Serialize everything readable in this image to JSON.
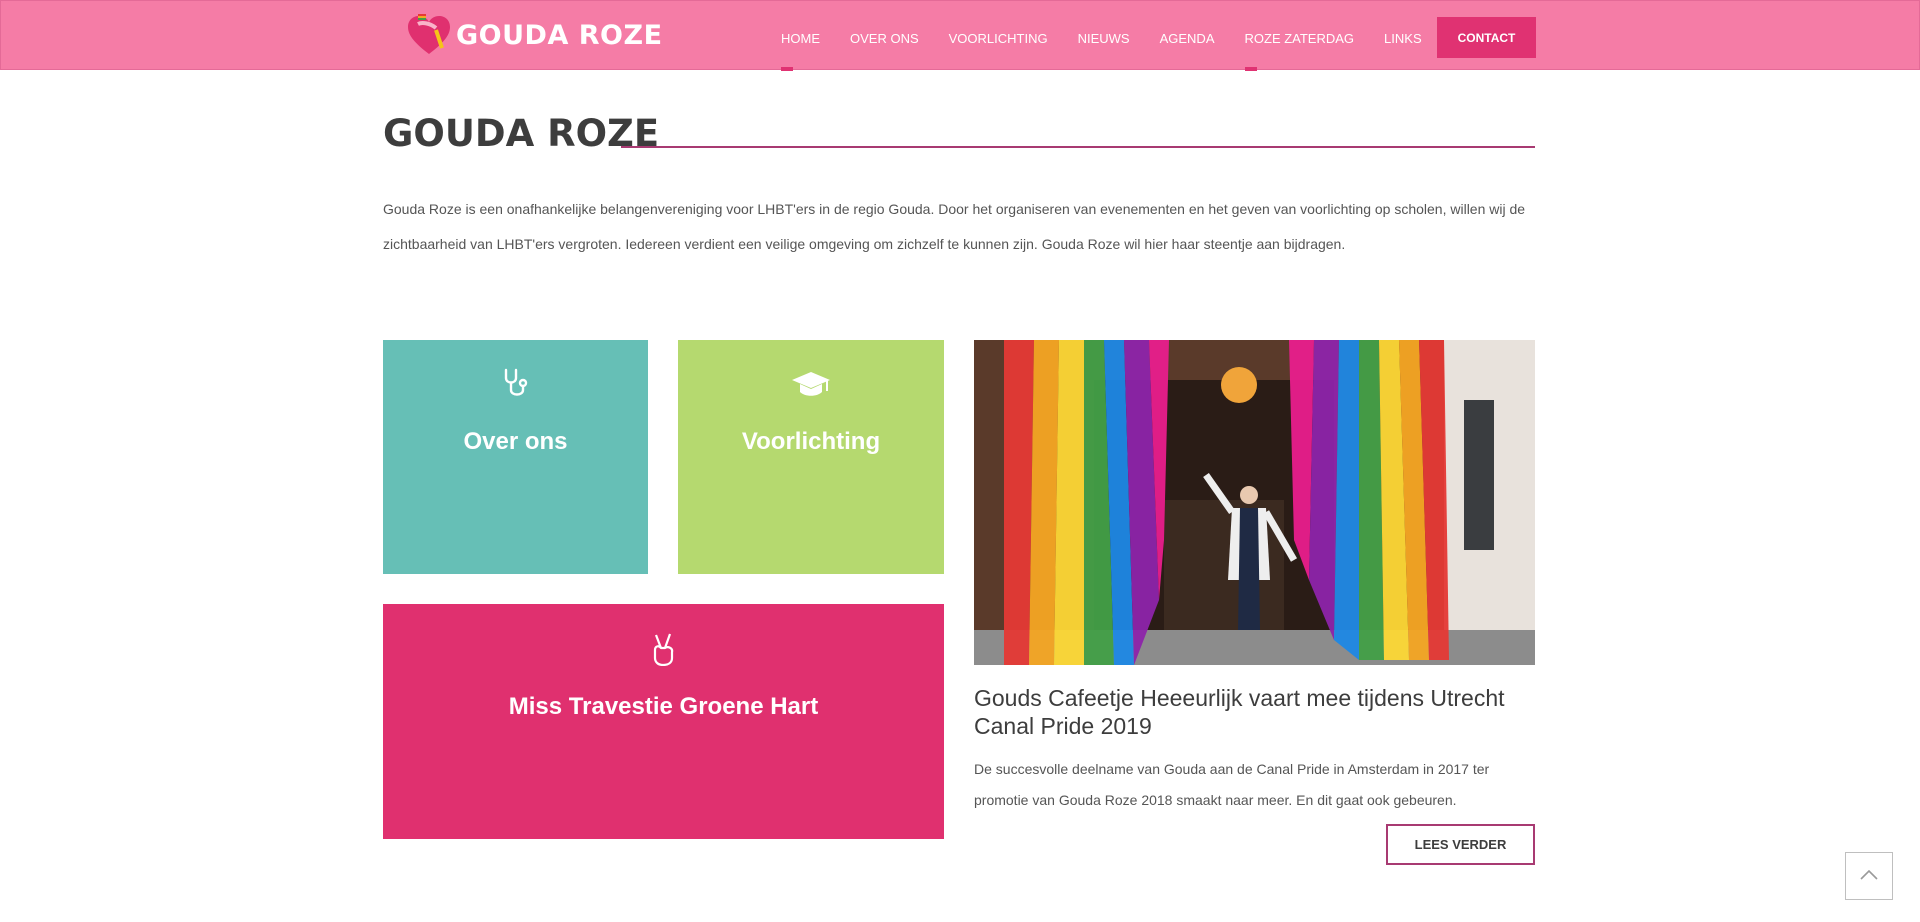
{
  "header": {
    "logo_text": "GOUDA ROZE",
    "nav": [
      {
        "label": "HOME"
      },
      {
        "label": "OVER ONS"
      },
      {
        "label": "VOORLICHTING"
      },
      {
        "label": "NIEUWS"
      },
      {
        "label": "AGENDA"
      },
      {
        "label": "ROZE ZATERDAG"
      },
      {
        "label": "LINKS"
      }
    ],
    "contact_label": "CONTACT"
  },
  "main": {
    "title": "GOUDA ROZE",
    "intro": "Gouda Roze is een onafhankelijke belangenvereniging voor LHBT'ers in de regio Gouda. Door het organiseren van evenementen en het geven van voorlichting op scholen, willen wij de zichtbaarheid van LHBT'ers vergroten. Iedereen verdient een veilige omgeving om zichzelf te kunnen zijn. Gouda Roze wil hier haar steentje aan bijdragen."
  },
  "tiles": [
    {
      "label": "Over ons",
      "icon": "stethoscope-icon",
      "color": "#66bfb6"
    },
    {
      "label": "Voorlichting",
      "icon": "graduation-cap-icon",
      "color": "#b5d96f"
    },
    {
      "label": "Miss Travestie Groene Hart",
      "icon": "peace-hand-icon",
      "color": "#e0306f"
    }
  ],
  "news": {
    "title": "Gouds Cafeetje Heeeurlijk vaart mee tijdens Utrecht Canal Pride 2019",
    "excerpt": "De succesvolle deelname van Gouda aan de Canal Pride in Amsterdam in 2017 ter promotie van Gouda Roze 2018 smaakt naar meer. En dit gaat ook gebeuren.",
    "read_more": "LEES VERDER"
  },
  "colors": {
    "header": "#f57ca6",
    "accent": "#e03272",
    "rule": "#a83a72"
  }
}
